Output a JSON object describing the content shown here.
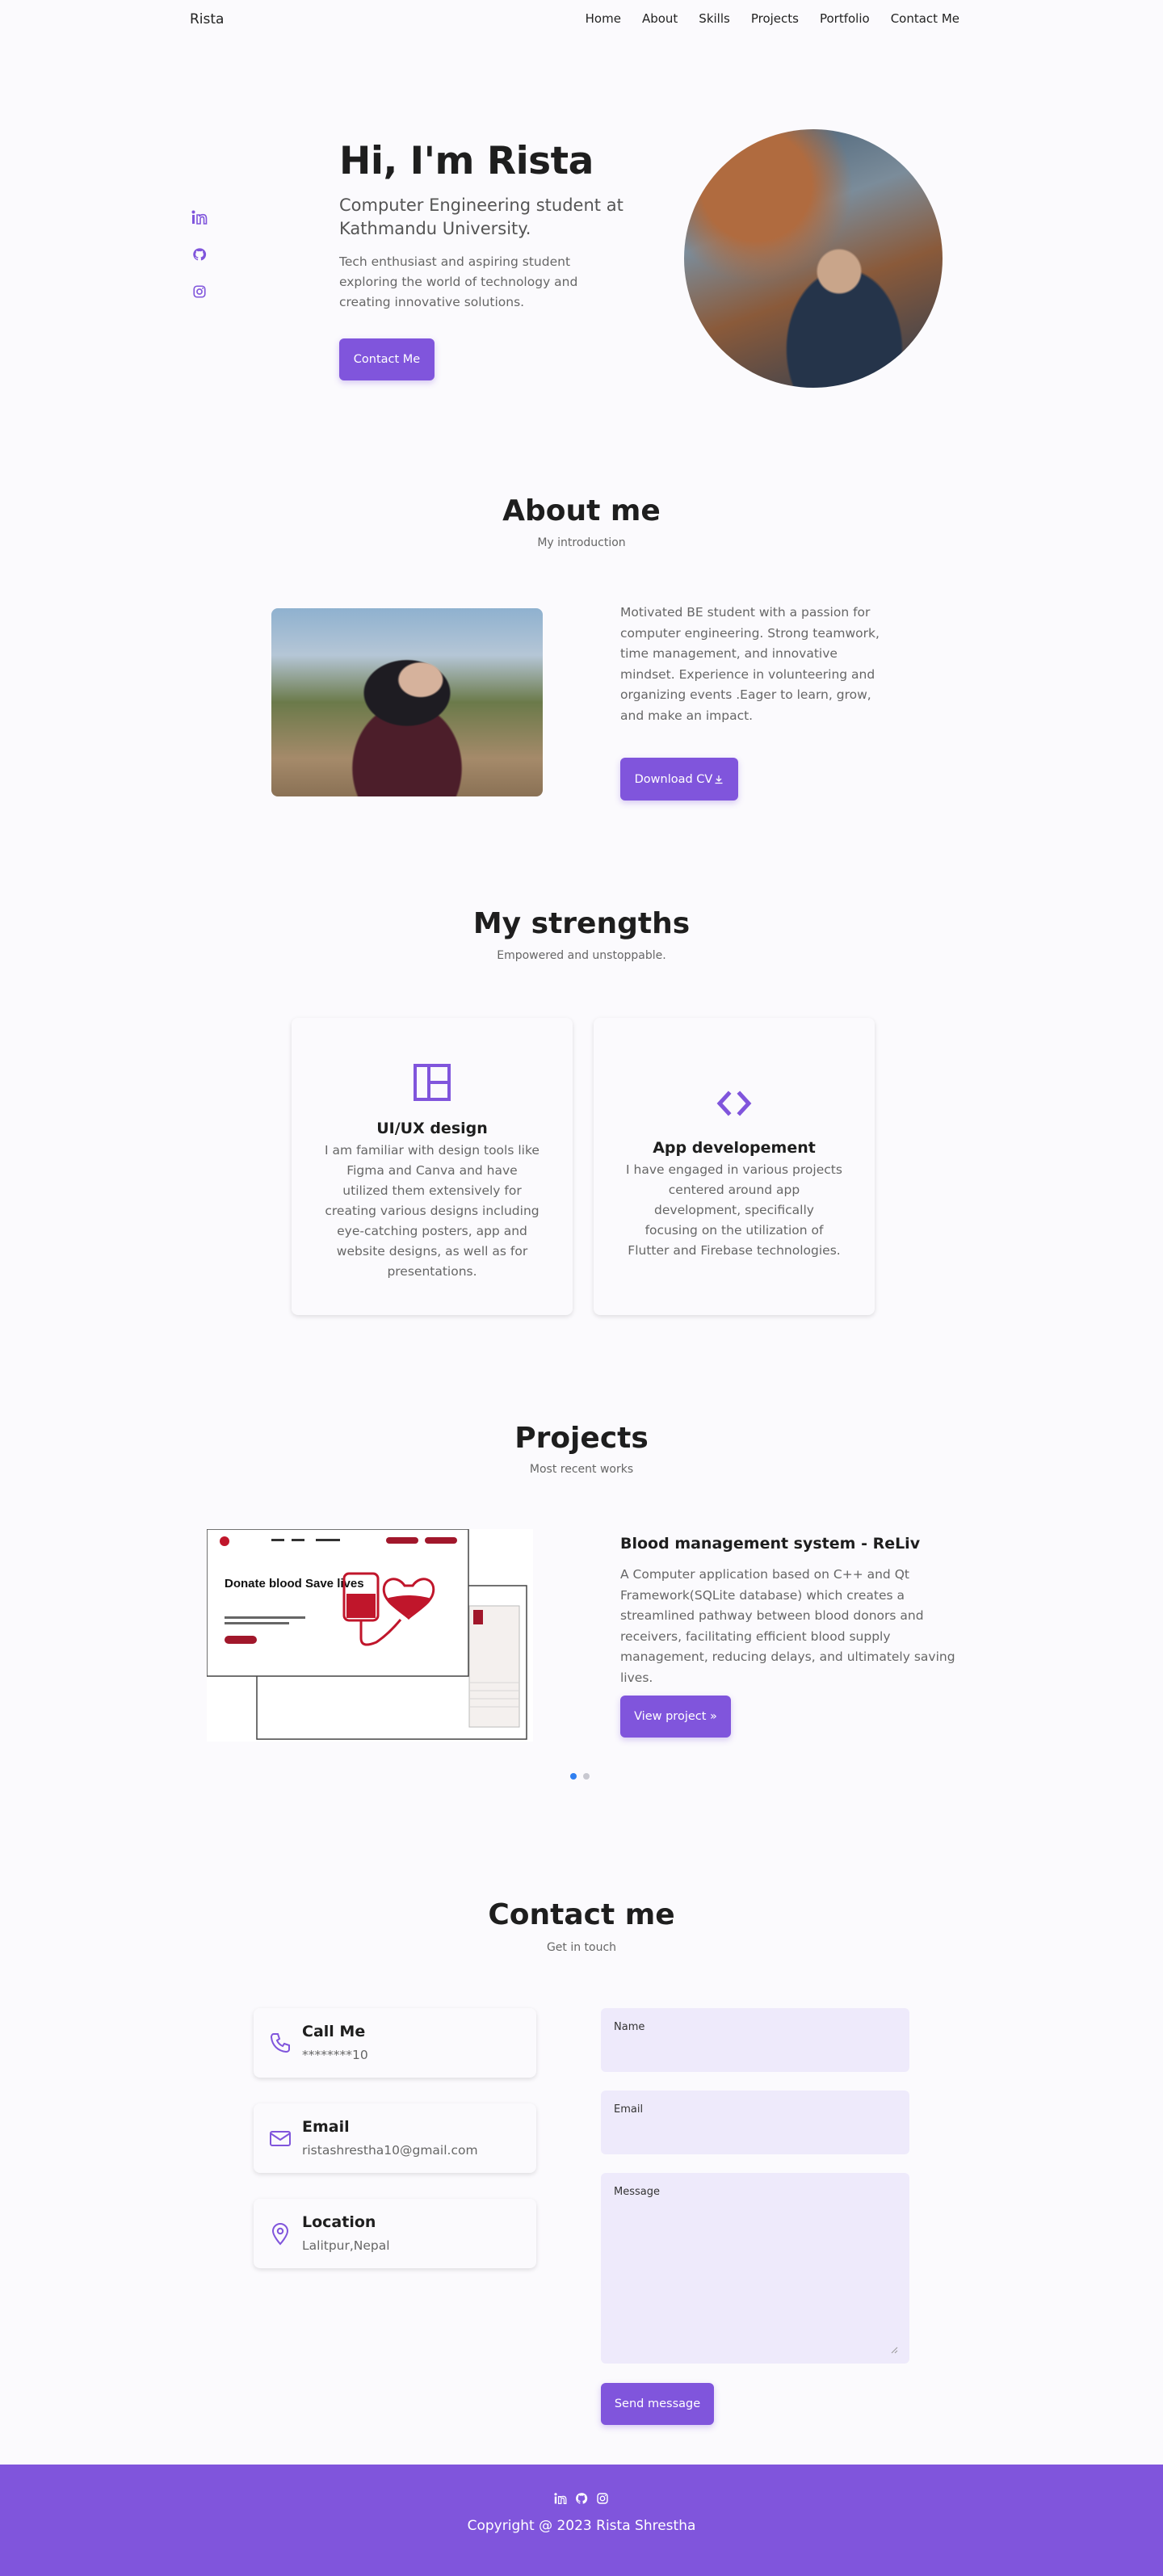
{
  "nav": {
    "brand": "Rista",
    "links": [
      "Home",
      "About",
      "Skills",
      "Projects",
      "Portfolio",
      "Contact Me"
    ]
  },
  "hero": {
    "title": "Hi, I'm Rista",
    "subtitle": "Computer Engineering student at Kathmandu University.",
    "description": "Tech enthusiast and aspiring student exploring the world of technology and creating innovative solutions.",
    "button": "Contact Me",
    "socials": [
      "linkedin-icon",
      "github-icon",
      "instagram-icon"
    ]
  },
  "about": {
    "title": "About me",
    "subtitle": "My introduction",
    "text": "Motivated BE student with a passion for computer engineering. Strong teamwork, time management, and innovative mindset. Experience in volunteering and organizing events .Eager to learn, grow, and make an impact.",
    "button": "Download CV"
  },
  "strengths": {
    "title": "My strengths",
    "subtitle": "Empowered and unstoppable.",
    "cards": [
      {
        "icon": "layout-icon",
        "title": "UI/UX design",
        "description": "I am familiar with design tools like Figma and Canva and have utilized them extensively for creating various designs including eye-catching posters, app and website designs, as well as for presentations."
      },
      {
        "icon": "code-icon",
        "title": "App developement",
        "description": "I have engaged in various projects centered around app development, specifically focusing on the utilization of Flutter and Firebase technologies."
      }
    ]
  },
  "projects": {
    "title": "Projects",
    "subtitle": "Most recent works",
    "item": {
      "title": "Blood management system - ReLiv",
      "description": "A Computer application based on C++ and Qt Framework(SQLite database) which creates a streamlined pathway between blood donors and receivers, facilitating efficient blood supply management, reducing delays, and ultimately saving lives.",
      "button": "View project »",
      "mock_heading": "Donate blood Save lives"
    },
    "slides": 2,
    "active_slide": 0
  },
  "contact": {
    "title": "Contact me",
    "subtitle": "Get in touch",
    "cards": [
      {
        "icon": "phone-icon",
        "label": "Call Me",
        "value": "********10"
      },
      {
        "icon": "mail-icon",
        "label": "Email",
        "value": "ristashrestha10@gmail.com"
      },
      {
        "icon": "location-pin-icon",
        "label": "Location",
        "value": "Lalitpur,Nepal"
      }
    ],
    "form": {
      "name_label": "Name",
      "email_label": "Email",
      "message_label": "Message",
      "button": "Send message"
    }
  },
  "footer": {
    "copyright": "Copyright @ 2023 Rista Shrestha"
  },
  "colors": {
    "accent": "#8055dc",
    "background": "#fbfafd",
    "field": "#eeeafb"
  }
}
